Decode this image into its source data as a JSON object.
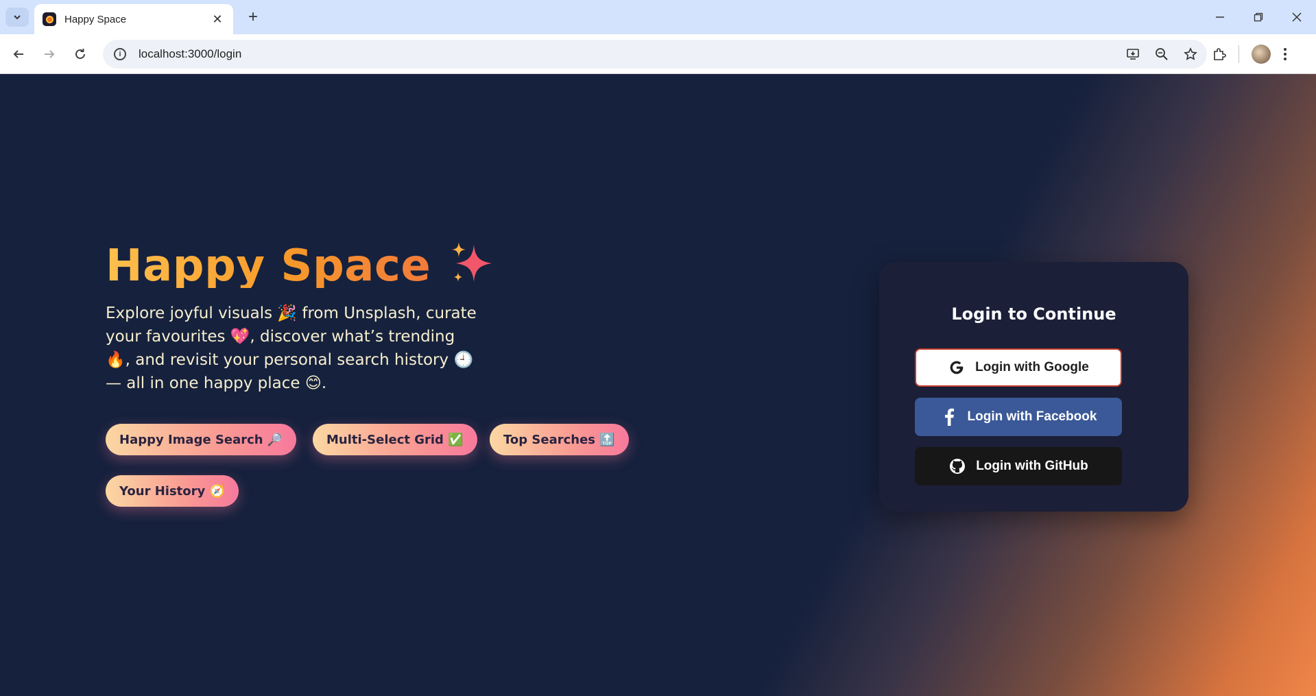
{
  "browser": {
    "tab_title": "Happy Space",
    "new_tab_symbol": "+",
    "close_symbol": "✕",
    "url": "localhost:3000/login"
  },
  "hero": {
    "title": "Happy Space",
    "description": "Explore joyful visuals 🎉 from Unsplash, curate your favourites 💖, discover what’s trending 🔥, and revisit your personal search history 🕘 — all in one happy place 😊."
  },
  "features": [
    {
      "label": "Happy Image Search 🔎"
    },
    {
      "label": "Multi-Select Grid ✅"
    },
    {
      "label": "Top Searches 🔝"
    },
    {
      "label": "Your History 🧭"
    }
  ],
  "login": {
    "title": "Login to Continue",
    "google": "Login with Google",
    "facebook": "Login with Facebook",
    "github": "Login with GitHub"
  },
  "colors": {
    "background": "#16213d",
    "accent_orange": "#f79a2a",
    "facebook_blue": "#3b5998",
    "github_black": "#171717"
  }
}
